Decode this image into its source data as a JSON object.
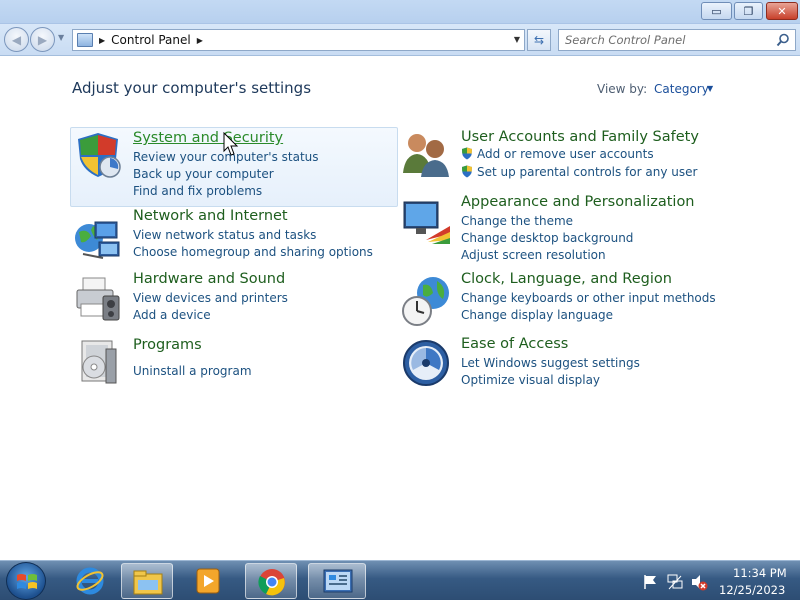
{
  "window": {
    "minimize_glyph": "▭",
    "maximize_glyph": "❐",
    "close_glyph": "✕"
  },
  "navigation": {
    "back_glyph": "◀",
    "forward_glyph": "▶",
    "breadcrumb": [
      "Control Panel"
    ],
    "search_placeholder": "Search Control Panel"
  },
  "header": {
    "title": "Adjust your computer's settings",
    "view_by_label": "View by:",
    "view_by_value": "Category"
  },
  "categories": [
    {
      "title": "System and Security",
      "icon": "shield-icon",
      "links": [
        "Review your computer's status",
        "Back up your computer",
        "Find and fix problems"
      ]
    },
    {
      "title": "Network and Internet",
      "icon": "network-globe-icon",
      "links": [
        "View network status and tasks",
        "Choose homegroup and sharing options"
      ]
    },
    {
      "title": "Hardware and Sound",
      "icon": "printer-icon",
      "links": [
        "View devices and printers",
        "Add a device"
      ]
    },
    {
      "title": "Programs",
      "icon": "programs-icon",
      "links": [
        "Uninstall a program"
      ]
    },
    {
      "title": "User Accounts and Family Safety",
      "icon": "users-icon",
      "links": [
        "Add or remove user accounts",
        "Set up parental controls for any user"
      ]
    },
    {
      "title": "Appearance and Personalization",
      "icon": "display-paint-icon",
      "links": [
        "Change the theme",
        "Change desktop background",
        "Adjust screen resolution"
      ]
    },
    {
      "title": "Clock, Language, and Region",
      "icon": "clock-globe-icon",
      "links": [
        "Change keyboards or other input methods",
        "Change display language"
      ]
    },
    {
      "title": "Ease of Access",
      "icon": "ease-of-access-icon",
      "links": [
        "Let Windows suggest settings",
        "Optimize visual display"
      ]
    }
  ],
  "taskbar": {
    "items": [
      "start-button",
      "internet-explorer-icon",
      "file-explorer-icon",
      "media-player-icon",
      "chrome-icon",
      "control-panel-icon"
    ],
    "time": "11:34 PM",
    "date": "12/25/2023"
  }
}
